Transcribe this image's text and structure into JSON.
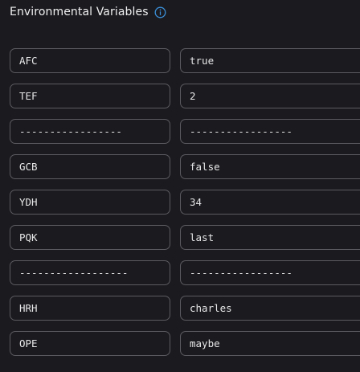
{
  "header": {
    "title": "Environmental Variables"
  },
  "variables": [
    {
      "key": "AFC",
      "value": "true"
    },
    {
      "key": "TEF",
      "value": "2"
    },
    {
      "key": "-----------------",
      "value": "-----------------"
    },
    {
      "key": "GCB",
      "value": "false"
    },
    {
      "key": "YDH",
      "value": "34"
    },
    {
      "key": "PQK",
      "value": "last"
    },
    {
      "key": "------------------",
      "value": "-----------------"
    },
    {
      "key": "HRH",
      "value": "charles"
    },
    {
      "key": "OPE",
      "value": "maybe"
    }
  ],
  "colors": {
    "background": "#1b1b1f",
    "border": "#5a5a60",
    "text": "#e6e6e8",
    "accent": "#3b8fd9"
  },
  "icons": {
    "info": "info-circle-icon"
  }
}
